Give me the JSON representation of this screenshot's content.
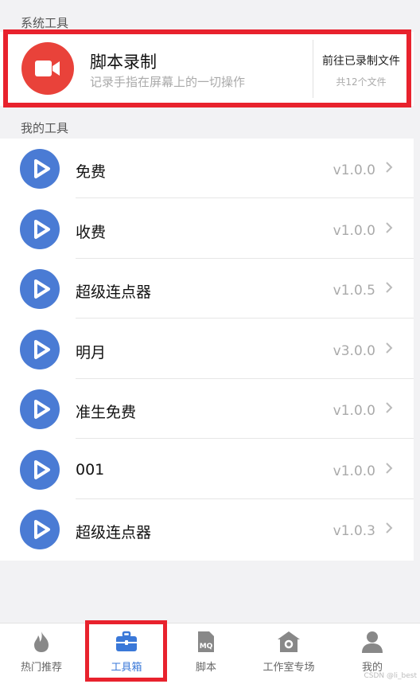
{
  "sections": {
    "system_tools": "系统工具",
    "my_tools": "我的工具"
  },
  "system_tool": {
    "icon": "video-camera-icon",
    "title": "脚本录制",
    "description": "记录手指在屏幕上的一切操作",
    "action_title": "前往已录制文件",
    "file_count": "共12个文件"
  },
  "tools": [
    {
      "name": "免费",
      "version": "v1.0.0"
    },
    {
      "name": "收费",
      "version": "v1.0.0"
    },
    {
      "name": "超级连点器",
      "version": "v1.0.5"
    },
    {
      "name": "明月",
      "version": "v3.0.0"
    },
    {
      "name": "准生免费",
      "version": "v1.0.0"
    },
    {
      "name": "001",
      "version": "v1.0.0"
    },
    {
      "name": "超级连点器",
      "version": "v1.0.3"
    }
  ],
  "tabs": [
    {
      "label": "热门推荐",
      "icon": "flame-icon",
      "active": false
    },
    {
      "label": "工具箱",
      "icon": "toolbox-icon",
      "active": true
    },
    {
      "label": "脚本",
      "icon": "mq-file-icon",
      "active": false
    },
    {
      "label": "工作室专场",
      "icon": "studio-house-icon",
      "active": false
    },
    {
      "label": "我的",
      "icon": "person-icon",
      "active": false
    }
  ],
  "watermark": "CSDN @li_best",
  "colors": {
    "accent": "#3a78d8",
    "record_red": "#e9423a",
    "play_blue": "#4a7bd4",
    "highlight_red": "#e8222d"
  }
}
